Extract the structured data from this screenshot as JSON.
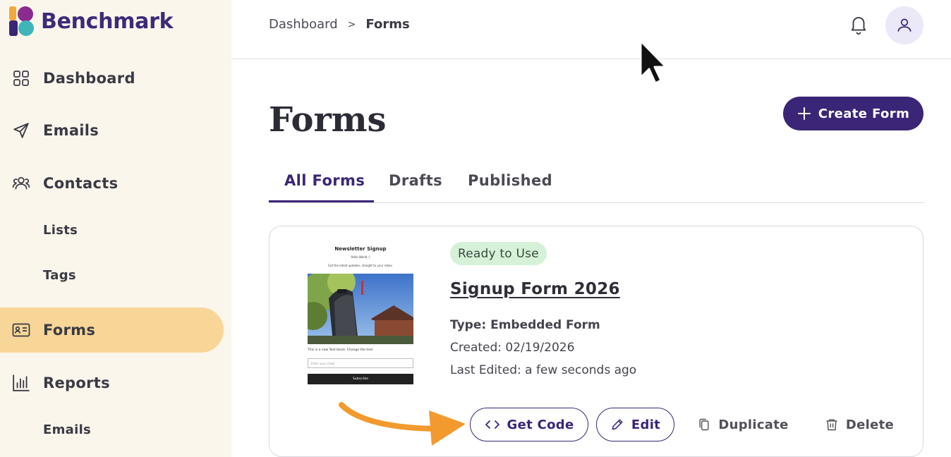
{
  "brand": {
    "name": "Benchmark"
  },
  "sidebar": {
    "items": [
      {
        "label": "Dashboard",
        "icon": "grid-icon"
      },
      {
        "label": "Emails",
        "icon": "send-icon"
      },
      {
        "label": "Contacts",
        "icon": "users-icon"
      },
      {
        "label": "Lists"
      },
      {
        "label": "Tags"
      },
      {
        "label": "Forms",
        "icon": "id-card-icon",
        "active": true
      },
      {
        "label": "Reports",
        "icon": "bar-chart-icon"
      },
      {
        "label": "Emails"
      }
    ]
  },
  "header": {
    "breadcrumb": {
      "parent": "Dashboard",
      "separator": ">",
      "current": "Forms"
    },
    "icons": [
      "bell-icon",
      "user-icon"
    ]
  },
  "main": {
    "title": "Forms",
    "create_button": "Create Form",
    "tabs": [
      {
        "label": "All Forms",
        "active": true
      },
      {
        "label": "Drafts"
      },
      {
        "label": "Published"
      }
    ]
  },
  "form_card": {
    "status": "Ready to Use",
    "name": "Signup Form 2026",
    "type": "Type: Embedded Form",
    "created": "Created: 02/19/2026",
    "last_edited": "Last Edited: a few seconds ago",
    "preview": {
      "title": "Newsletter Signup",
      "hello": "Hello World :)",
      "subtitle": "Get the latest updates, straight to your inbox.",
      "text_block": "This is a new Text block. Change the text.",
      "email_placeholder": "Enter your email",
      "subscribe": "Subscribe"
    },
    "actions": {
      "get_code": "Get Code",
      "edit": "Edit",
      "duplicate": "Duplicate",
      "delete": "Delete"
    }
  },
  "colors": {
    "accent": "#3b2577",
    "sidebar_bg": "#fbf6ec",
    "active_nav": "#f7d698",
    "status_bg": "#d5f2d8",
    "annotation_arrow": "#f29a2e"
  }
}
